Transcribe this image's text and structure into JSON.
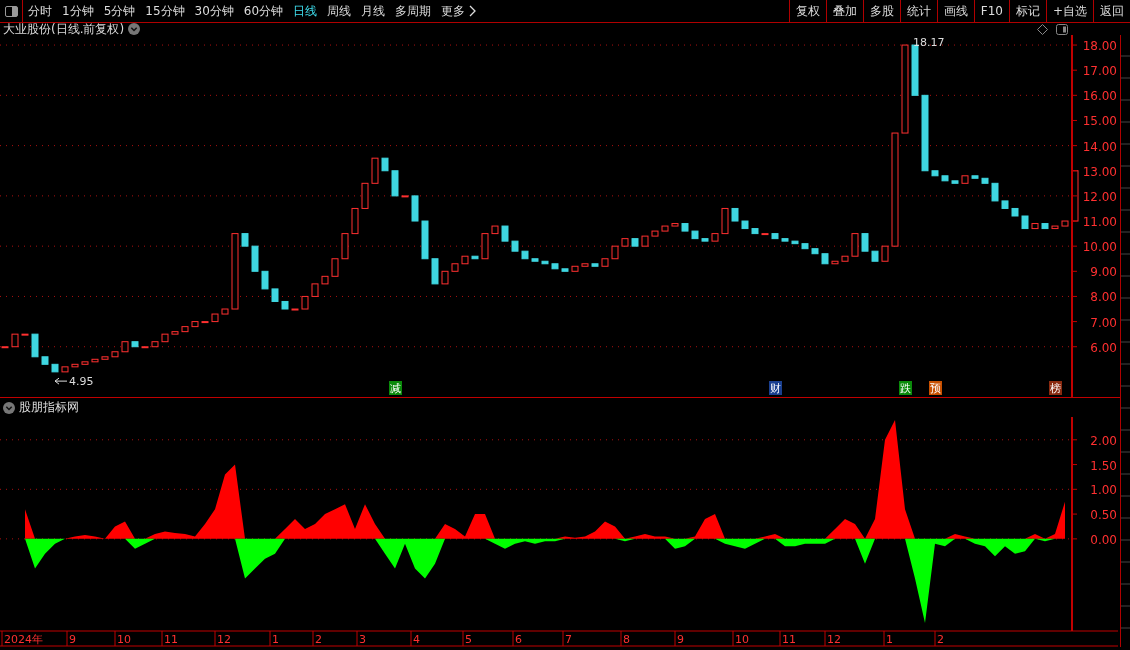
{
  "toolbar": {
    "periods": [
      {
        "label": "分时",
        "selected": false
      },
      {
        "label": "1分钟",
        "selected": false
      },
      {
        "label": "5分钟",
        "selected": false
      },
      {
        "label": "15分钟",
        "selected": false
      },
      {
        "label": "30分钟",
        "selected": false
      },
      {
        "label": "60分钟",
        "selected": false
      },
      {
        "label": "日线",
        "selected": true
      },
      {
        "label": "周线",
        "selected": false
      },
      {
        "label": "月线",
        "selected": false
      },
      {
        "label": "多周期",
        "selected": false
      }
    ],
    "more": "更多",
    "actions": [
      "复权",
      "叠加",
      "多股",
      "统计",
      "画线",
      "F10",
      "标记",
      "+自选",
      "返回"
    ]
  },
  "price_panel": {
    "title": "大业股份(日线.前复权)",
    "axis_labels": [
      "18.00",
      "17.00",
      "16.00",
      "15.00",
      "14.00",
      "13.00",
      "12.00",
      "11.00",
      "10.00",
      "9.00",
      "8.00",
      "7.00",
      "6.00"
    ],
    "high_label": "18.17",
    "low_label": "4.95",
    "event_markers": [
      {
        "text": "减",
        "color": "#0a8a0a"
      },
      {
        "text": "财",
        "color": "#1a3f8f"
      },
      {
        "text": "跌",
        "color": "#0a8a0a"
      },
      {
        "text": "预",
        "color": "#c85000"
      },
      {
        "text": "榜",
        "color": "#8a2a10"
      }
    ]
  },
  "indicator_panel": {
    "title": "股朋指标网",
    "month_labels": [
      "2024年",
      "9",
      "10",
      "11",
      "12",
      "1",
      "2",
      "3",
      "4",
      "5",
      "6",
      "7",
      "8",
      "9",
      "10",
      "11",
      "12",
      "1",
      "2"
    ],
    "chart_data": {
      "type": "area",
      "grid": true,
      "ylim": [
        -1.86,
        2.46
      ],
      "yticks": [
        {
          "value": 0,
          "label": "0.00"
        },
        {
          "value": 0.5,
          "label": "0.50"
        },
        {
          "value": 1,
          "label": "1.00"
        },
        {
          "value": 1.5,
          "label": "1.50"
        },
        {
          "value": 2,
          "label": "2.00"
        }
      ],
      "series": [
        {
          "color": "#ff0000",
          "values": [
            null,
            null,
            0.6,
            0,
            0,
            0,
            0,
            0.05,
            0.08,
            0.05,
            0,
            0.25,
            0.35,
            0,
            0,
            0.1,
            0.15,
            0.12,
            0.1,
            0.05,
            0.3,
            0.6,
            1.3,
            1.5,
            0,
            0,
            0,
            0,
            0.2,
            0.4,
            0.2,
            0.3,
            0.5,
            0.6,
            0.7,
            0.2,
            0.7,
            0.3,
            0,
            0,
            0,
            0,
            0,
            0,
            0.3,
            0.2,
            0.05,
            0.5,
            0.5,
            0,
            0,
            0,
            0,
            0,
            0,
            0,
            0.05,
            0.02,
            0.05,
            0.15,
            0.35,
            0.25,
            0,
            0.05,
            0.1,
            0.05,
            0.05,
            0,
            0,
            0.05,
            0.4,
            0.5,
            0,
            0,
            0,
            0,
            0.05,
            0.1,
            0,
            0,
            0,
            0,
            0,
            0.2,
            0.4,
            0.3,
            0,
            0.4,
            2.0,
            2.4,
            0.6,
            0,
            0,
            0,
            0,
            0.1,
            0.05,
            0,
            0,
            0,
            0,
            0,
            0,
            0.1,
            0,
            0.1,
            0.75
          ]
        },
        {
          "color": "#00ff00",
          "values": [
            null,
            null,
            0,
            -0.6,
            -0.3,
            -0.1,
            0,
            0,
            0,
            0,
            0,
            0,
            0,
            -0.2,
            -0.1,
            0,
            0,
            0,
            0,
            0,
            0,
            0,
            0,
            0,
            -0.8,
            -0.6,
            -0.4,
            -0.3,
            0,
            0,
            0,
            0,
            0,
            0,
            0,
            0,
            0,
            0,
            -0.3,
            -0.6,
            -0.1,
            -0.6,
            -0.8,
            -0.5,
            0,
            0,
            0,
            0,
            0,
            -0.1,
            -0.2,
            -0.1,
            -0.05,
            -0.1,
            -0.05,
            -0.05,
            0,
            0,
            0,
            0,
            0,
            0,
            -0.05,
            0,
            0,
            0,
            0,
            -0.2,
            -0.15,
            0,
            0,
            0,
            -0.1,
            -0.15,
            -0.2,
            -0.1,
            0,
            0,
            -0.15,
            -0.15,
            -0.1,
            -0.1,
            -0.1,
            0,
            0,
            0,
            -0.5,
            0,
            0,
            0,
            0,
            -0.8,
            -1.7,
            -0.1,
            -0.15,
            0,
            0,
            -0.1,
            -0.15,
            -0.35,
            -0.15,
            -0.3,
            -0.25,
            0,
            -0.05,
            0,
            0
          ]
        }
      ]
    }
  }
}
